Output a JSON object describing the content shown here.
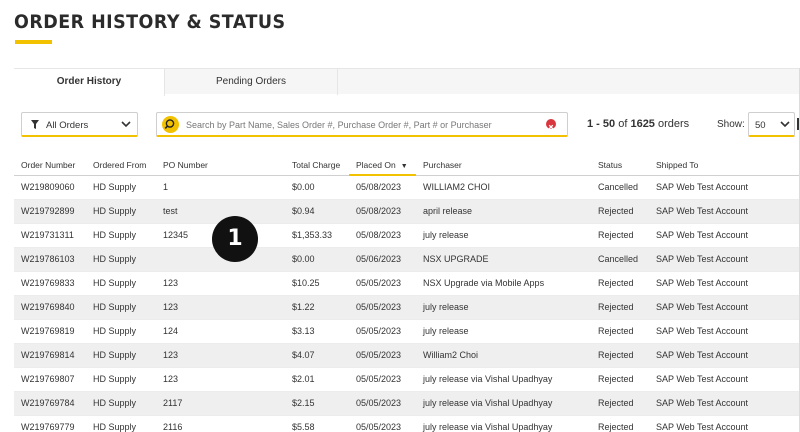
{
  "page": {
    "title": "ORDER HISTORY & STATUS",
    "accent_color": "#f2c200"
  },
  "tabs": [
    {
      "label": "Order History",
      "active": true
    },
    {
      "label": "Pending Orders",
      "active": false
    }
  ],
  "filters": {
    "status_filter": {
      "value": "All Orders",
      "icon": "funnel-icon"
    },
    "search": {
      "placeholder": "Search by Part Name, Sales Order #, Purchase Order #, Part # or Purchaser",
      "icon": "search-icon",
      "clear_icon": "clear-icon"
    }
  },
  "pagination": {
    "range": "1 - 50",
    "of": "of",
    "total": "1625",
    "unit": "orders",
    "show_label": "Show:",
    "page_size": "50"
  },
  "table": {
    "columns": [
      "Order Number",
      "Ordered From",
      "PO Number",
      "Total Charge",
      "Placed On",
      "Purchaser",
      "Status",
      "Shipped To"
    ],
    "sorted_column": "Placed On",
    "rows": [
      [
        "W219809060",
        "HD Supply",
        "1",
        "$0.00",
        "05/08/2023",
        "WILLIAM2 CHOI",
        "Cancelled",
        "SAP Web Test Account"
      ],
      [
        "W219792899",
        "HD Supply",
        "test",
        "$0.94",
        "05/08/2023",
        "april release",
        "Rejected",
        "SAP Web Test Account"
      ],
      [
        "W219731311",
        "HD Supply",
        "12345",
        "$1,353.33",
        "05/08/2023",
        "july release",
        "Rejected",
        "SAP Web Test Account"
      ],
      [
        "W219786103",
        "HD Supply",
        "",
        "$0.00",
        "05/06/2023",
        "NSX UPGRADE",
        "Cancelled",
        "SAP Web Test Account"
      ],
      [
        "W219769833",
        "HD Supply",
        "123",
        "$10.25",
        "05/05/2023",
        "NSX Upgrade via Mobile Apps",
        "Rejected",
        "SAP Web Test Account"
      ],
      [
        "W219769840",
        "HD Supply",
        "123",
        "$1.22",
        "05/05/2023",
        "july release",
        "Rejected",
        "SAP Web Test Account"
      ],
      [
        "W219769819",
        "HD Supply",
        "124",
        "$3.13",
        "05/05/2023",
        "july release",
        "Rejected",
        "SAP Web Test Account"
      ],
      [
        "W219769814",
        "HD Supply",
        "123",
        "$4.07",
        "05/05/2023",
        "William2 Choi",
        "Rejected",
        "SAP Web Test Account"
      ],
      [
        "W219769807",
        "HD Supply",
        "123",
        "$2.01",
        "05/05/2023",
        "july release via Vishal Upadhyay",
        "Rejected",
        "SAP Web Test Account"
      ],
      [
        "W219769784",
        "HD Supply",
        "2117",
        "$2.15",
        "05/05/2023",
        "july release via Vishal Upadhyay",
        "Rejected",
        "SAP Web Test Account"
      ],
      [
        "W219769779",
        "HD Supply",
        "2116",
        "$5.58",
        "05/05/2023",
        "july release via Vishal Upadhyay",
        "Rejected",
        "SAP Web Test Account"
      ]
    ]
  },
  "annotation": {
    "step": "1"
  }
}
